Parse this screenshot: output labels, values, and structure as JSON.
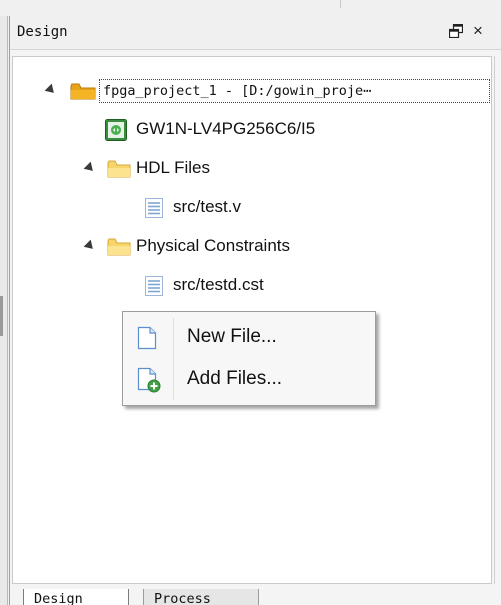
{
  "panel": {
    "title": "Design",
    "float_icon": "float-window-icon",
    "close_glyph": "×"
  },
  "tree": {
    "project": {
      "label": "fpga_project_1 - [D:/gowin_proje⋯",
      "icon": "project-folder-icon"
    },
    "device": {
      "label": "GW1N-LV4PG256C6/I5",
      "icon": "chip-icon"
    },
    "hdl_group": {
      "label": "HDL Files",
      "icon": "folder-icon",
      "files": [
        {
          "label": "src/test.v",
          "icon": "file-icon"
        }
      ]
    },
    "constraints_group": {
      "label": "Physical Constraints",
      "icon": "folder-icon",
      "files": [
        {
          "label": "src/testd.cst",
          "icon": "file-icon"
        }
      ]
    }
  },
  "context_menu": {
    "items": [
      {
        "label": "New File...",
        "icon": "new-file-icon"
      },
      {
        "label": "Add Files...",
        "icon": "add-files-icon"
      }
    ]
  },
  "tabs": [
    {
      "label": "Design",
      "active": true
    },
    {
      "label": "Process",
      "active": false
    }
  ],
  "colors": {
    "folder": "#f5c518",
    "project_folder": "#e8a317",
    "chip_green": "#2e7d32",
    "file_lines": "#7fa7d6"
  }
}
